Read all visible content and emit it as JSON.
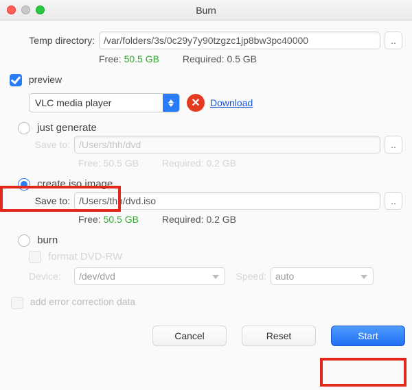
{
  "window": {
    "title": "Burn"
  },
  "temp": {
    "label": "Temp directory:",
    "path": "/var/folders/3s/0c29y7y90tzgzc1jp8bw3pc40000",
    "browse": "..",
    "free_label": "Free:",
    "free_value": "50.5 GB",
    "req_label": "Required:",
    "req_value": "0.5 GB"
  },
  "preview": {
    "label": "preview",
    "player": "VLC media player",
    "download": "Download"
  },
  "just_generate": {
    "label": "just generate",
    "save_label": "Save to:",
    "save_path": "/Users/thh/dvd",
    "browse": "..",
    "free_label": "Free:",
    "free_value": "50.5 GB",
    "req_label": "Required:",
    "req_value": "0.2 GB"
  },
  "create_iso": {
    "label": "create iso image",
    "save_label": "Save to:",
    "save_path": "/Users/thh/dvd.iso",
    "browse": "..",
    "free_label": "Free:",
    "free_value": "50.5 GB",
    "req_label": "Required:",
    "req_value": "0.2 GB"
  },
  "burn": {
    "label": "burn",
    "format_label": "format DVD-RW",
    "device_label": "Device:",
    "device_value": "/dev/dvd",
    "speed_label": "Speed:",
    "speed_value": "auto"
  },
  "ecc": {
    "label": "add error correction data"
  },
  "footer": {
    "cancel": "Cancel",
    "reset": "Reset",
    "start": "Start"
  }
}
